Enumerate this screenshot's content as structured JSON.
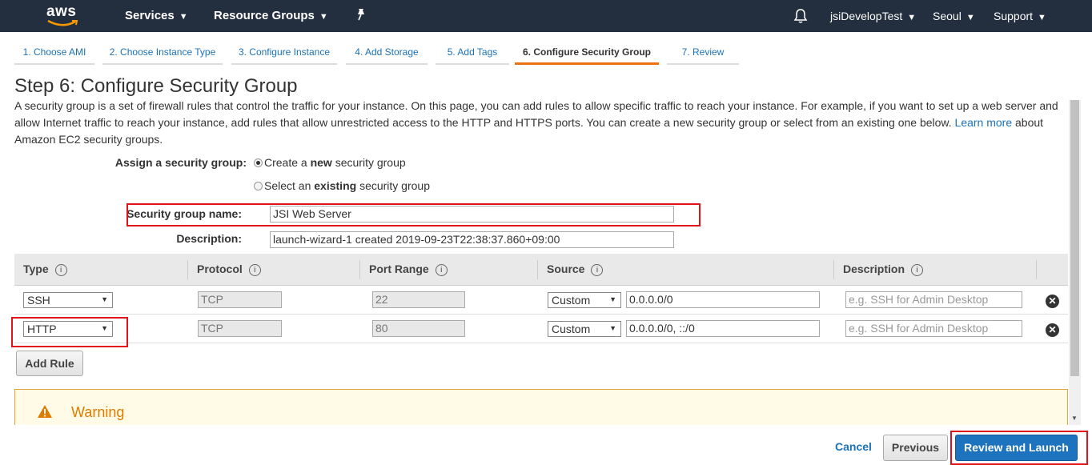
{
  "nav": {
    "logo": "aws",
    "services": "Services",
    "resource_groups": "Resource Groups",
    "account": "jsiDevelopTest",
    "region": "Seoul",
    "support": "Support"
  },
  "tabs": [
    {
      "label": "1. Choose AMI"
    },
    {
      "label": "2. Choose Instance Type"
    },
    {
      "label": "3. Configure Instance"
    },
    {
      "label": "4. Add Storage"
    },
    {
      "label": "5. Add Tags"
    },
    {
      "label": "6. Configure Security Group"
    },
    {
      "label": "7. Review"
    }
  ],
  "page": {
    "title": "Step 6: Configure Security Group",
    "intro_text": "A security group is a set of firewall rules that control the traffic for your instance. On this page, you can add rules to allow specific traffic to reach your instance. For example, if you want to set up a web server and allow Internet traffic to reach your instance, add rules that allow unrestricted access to the HTTP and HTTPS ports. You can create a new security group or select from an existing one below.",
    "learn_more": "Learn more",
    "intro_suffix": "about Amazon EC2 security groups."
  },
  "form": {
    "assign_label": "Assign a security group:",
    "option_new_pre": "Create a",
    "option_new_bold": "new",
    "option_new_post": "security group",
    "option_existing_pre": "Select an",
    "option_existing_bold": "existing",
    "option_existing_post": "security group",
    "selected_option": "new",
    "name_label": "Security group name:",
    "name_value": "JSI Web Server",
    "desc_label": "Description:",
    "desc_value": "launch-wizard-1 created 2019-09-23T22:38:37.860+09:00"
  },
  "table": {
    "headers": [
      "Type",
      "Protocol",
      "Port Range",
      "Source",
      "Description"
    ],
    "info_glyph": "i",
    "rows": [
      {
        "type": "SSH",
        "protocol": "TCP",
        "port": "22",
        "source_mode": "Custom",
        "source": "0.0.0.0/0",
        "desc_placeholder": "e.g. SSH for Admin Desktop"
      },
      {
        "type": "HTTP",
        "protocol": "TCP",
        "port": "80",
        "source_mode": "Custom",
        "source": "0.0.0.0/0, ::/0",
        "desc_placeholder": "e.g. SSH for Admin Desktop"
      }
    ],
    "add_rule": "Add Rule"
  },
  "warning": {
    "title": "Warning"
  },
  "footer": {
    "cancel": "Cancel",
    "previous": "Previous",
    "review": "Review and Launch"
  },
  "colors": {
    "nav_bg": "#232f3e",
    "accent_orange": "#ec7211",
    "link_blue": "#1b72b7",
    "primary_blue": "#1e73be",
    "highlight_red": "#e0131b"
  }
}
